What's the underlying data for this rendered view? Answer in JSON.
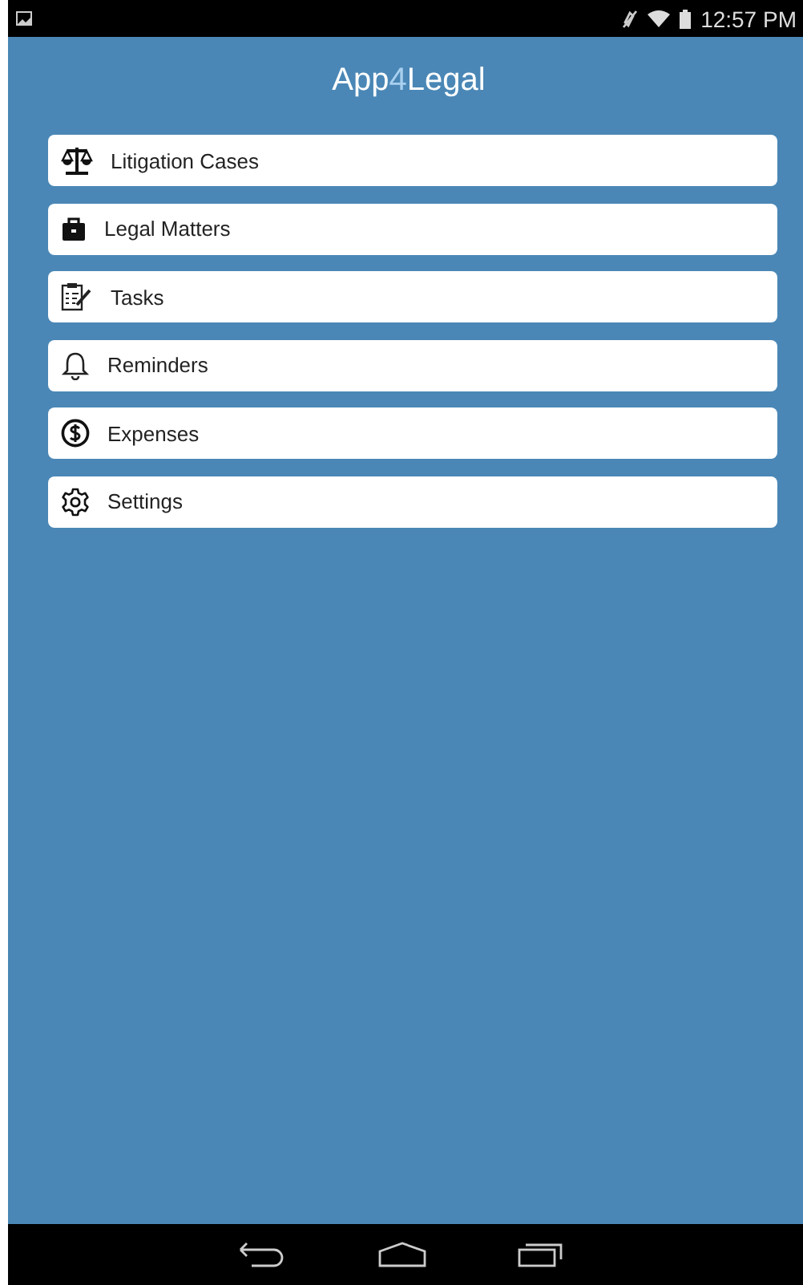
{
  "status_bar": {
    "time": "12:57 PM"
  },
  "app_title": [
    {
      "text": "App",
      "accent": false
    },
    {
      "text": "4",
      "accent": true
    },
    {
      "text": "Legal",
      "accent": false
    }
  ],
  "menu": [
    {
      "label": "Litigation Cases",
      "kind": "scales"
    },
    {
      "label": "Legal Matters",
      "kind": "briefcase"
    },
    {
      "label": "Tasks",
      "kind": "clipboard"
    },
    {
      "label": "Reminders",
      "kind": "bell"
    },
    {
      "label": "Expenses",
      "kind": "dollar"
    },
    {
      "label": "Settings",
      "kind": "gear"
    }
  ]
}
